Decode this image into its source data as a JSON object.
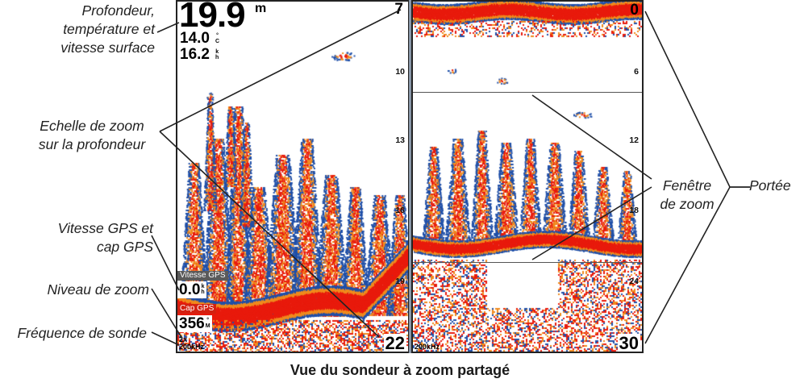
{
  "callouts": {
    "depth_temp_speed": [
      "Profondeur,",
      "température et",
      "vitesse surface"
    ],
    "zoom_scale": [
      "Echelle de zoom",
      "sur la profondeur"
    ],
    "gps_speed_course": [
      "Vitesse GPS et",
      "cap GPS"
    ],
    "zoom_level": "Niveau de zoom",
    "sonar_frequency": "Fréquence de sonde",
    "zoom_window": [
      "Fenêtre",
      "de zoom"
    ],
    "range": "Portée"
  },
  "left_screen": {
    "depth_value": "19.9",
    "depth_unit": "m",
    "temperature_value": "14.0",
    "temperature_unit": [
      "°",
      "C"
    ],
    "surface_speed_value": "16.2",
    "surface_speed_unit": [
      "k",
      "h"
    ],
    "top_depth": "7",
    "depth_ticks": [
      "10",
      "13",
      "16",
      "19"
    ],
    "bottom_depth": "22",
    "gps_speed_label": "Vitesse GPS",
    "gps_speed_value": "0.0",
    "gps_speed_unit": [
      "k",
      "h"
    ],
    "gps_course_label": "Cap GPS",
    "gps_course_value": "356",
    "gps_course_unit": [
      "°",
      "M"
    ],
    "zoom_level": "2x",
    "frequency": "200kHz"
  },
  "right_screen": {
    "top_depth": "0",
    "depth_ticks": [
      "6",
      "12",
      "18",
      "24"
    ],
    "bottom_depth": "30",
    "frequency": "200kHz"
  },
  "caption": "Vue du sondeur à zoom partagé",
  "colors": {
    "sonar_strong": "#e81a0c",
    "sonar_medium": "#f08a1c",
    "sonar_weak": "#1f4fa8",
    "sonar_background": "#ffffff",
    "divider": "#8a97a8",
    "gps_label_background": "#5a5a5a",
    "course_label_background": "#d42010"
  }
}
